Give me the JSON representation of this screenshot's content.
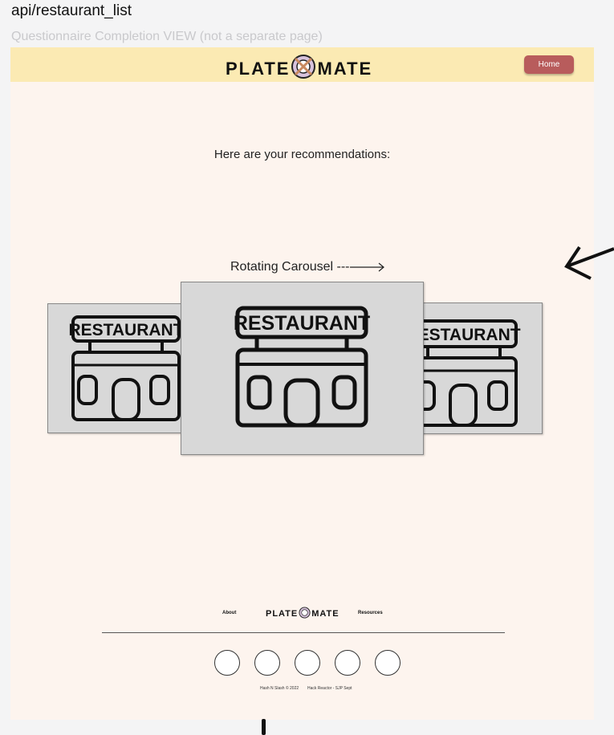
{
  "frame": {
    "title": "api/restaurant_list",
    "subtitle": "Questionnaire Completion VIEW (not a separate page)"
  },
  "header": {
    "logo_left": "PLATE",
    "logo_right": "MATE",
    "home_label": "Home",
    "background": "#fbeab3",
    "button_color": "#b85c5c"
  },
  "main": {
    "recommendations_text": "Here are your recommendations:",
    "carousel_note": "Rotating Carousel ---",
    "cards": [
      {
        "sign": "RESTAURANT"
      },
      {
        "sign": "RESTAURANT"
      },
      {
        "sign": "RESTAURANT"
      }
    ]
  },
  "footer": {
    "about": "About",
    "resources": "Resources",
    "logo_left": "PLATE",
    "logo_right": "MATE",
    "copyright": "Hash N Slash © 2022",
    "credit": "Hack Reactor - SJP Sept",
    "avatars": [
      "avatar-icon",
      "avatar-icon",
      "avatar-icon",
      "avatar-icon",
      "avatar-icon"
    ]
  },
  "colors": {
    "page": "#fdf4ee",
    "card": "#d8d8d8"
  }
}
